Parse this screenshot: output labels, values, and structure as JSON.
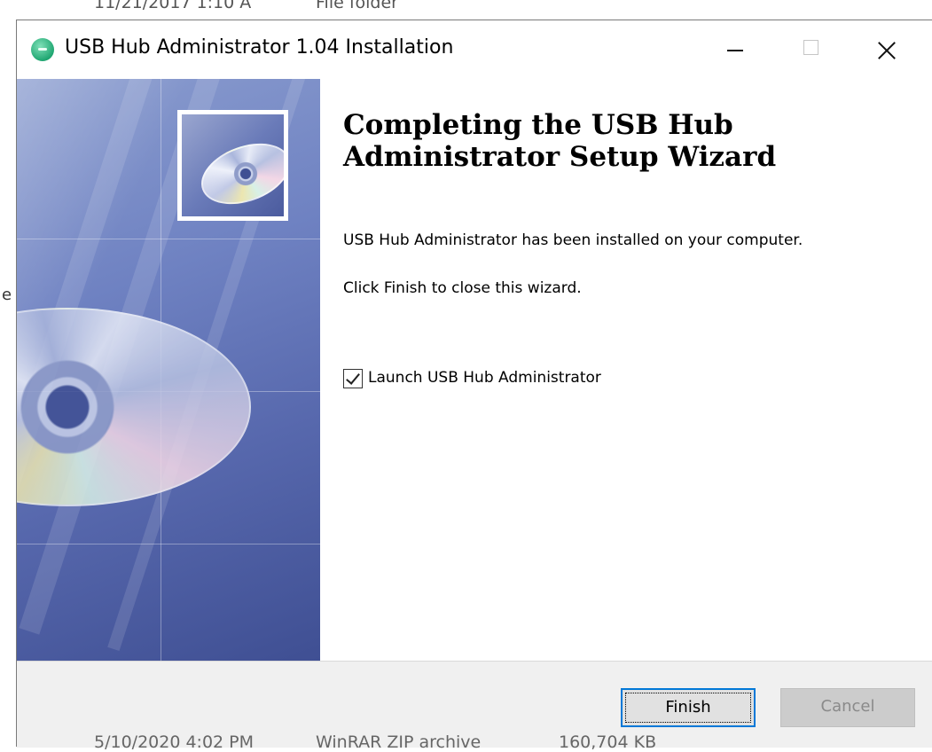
{
  "background": {
    "top_date": "11/21/2017 1:10 A",
    "top_type": "File folder",
    "edge_char": "e",
    "bottom_text": "5/10/2020 4:02 PM",
    "bottom_type": "WinRAR ZIP archive",
    "bottom_size": "160,704 KB"
  },
  "window": {
    "title": "USB Hub Administrator 1.04 Installation",
    "app_icon": "usb-hub-icon",
    "controls": [
      "minimize-icon",
      "maximize-icon",
      "close-icon"
    ]
  },
  "content": {
    "heading": "Completing the USB Hub Administrator Setup Wizard",
    "message_installed": "USB Hub Administrator has been installed on your computer.",
    "message_close": "Click Finish to close this wizard.",
    "launch_checkbox": {
      "label": "Launch USB Hub Administrator",
      "checked": true
    }
  },
  "footer": {
    "finish_label": "Finish",
    "cancel_label": "Cancel"
  },
  "colors": {
    "focus_border": "#0078d7",
    "banner_dark": "#3f4f93",
    "banner_light": "#8b9dcf",
    "footer_bg": "#f0f0f0"
  }
}
